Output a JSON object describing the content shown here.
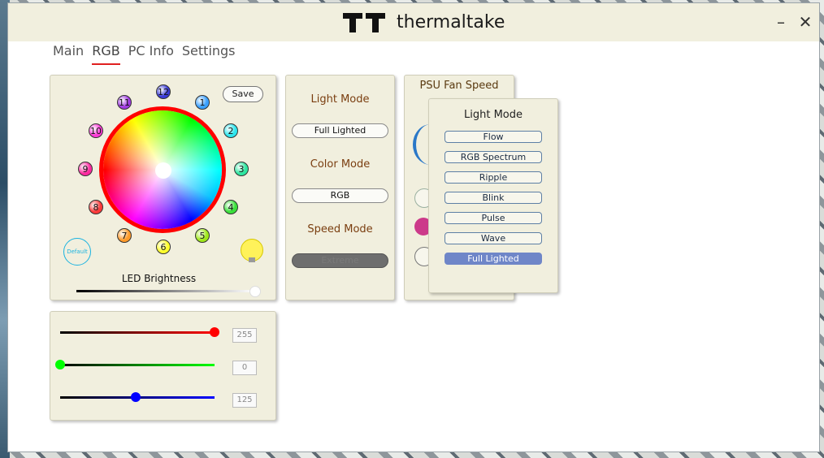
{
  "window": {
    "brand": "thermaltake",
    "minimize_glyph": "–",
    "close_glyph": "✕"
  },
  "tabs": [
    {
      "label": "Main"
    },
    {
      "label": "RGB"
    },
    {
      "label": "PC Info"
    },
    {
      "label": "Settings"
    }
  ],
  "active_tab": "RGB",
  "rgb_panel": {
    "save_label": "Save",
    "default_label": "Default",
    "brightness_label": "LED Brightness",
    "brightness_level": 1.0,
    "leds": [
      {
        "num": "12",
        "color": "#3a3ad8"
      },
      {
        "num": "1",
        "color": "#3aa0ff"
      },
      {
        "num": "2",
        "color": "#2ee6ee"
      },
      {
        "num": "3",
        "color": "#2ee6a0"
      },
      {
        "num": "4",
        "color": "#3ae03a"
      },
      {
        "num": "5",
        "color": "#9fe81a"
      },
      {
        "num": "6",
        "color": "#ffff2a"
      },
      {
        "num": "7",
        "color": "#ff9a2a"
      },
      {
        "num": "8",
        "color": "#ff3a3a"
      },
      {
        "num": "9",
        "color": "#ff2aa0"
      },
      {
        "num": "10",
        "color": "#ff3ad8"
      },
      {
        "num": "11",
        "color": "#a03ae0"
      }
    ]
  },
  "color_sliders": [
    {
      "value": "255",
      "color": "#ff0000",
      "level": 1.0
    },
    {
      "value": "0",
      "color": "#00ff00",
      "level": 0.0
    },
    {
      "value": "125",
      "color": "#0000ff",
      "level": 0.49
    }
  ],
  "mode_panel": {
    "light_mode_title": "Light Mode",
    "light_mode_value": "Full Lighted",
    "color_mode_title": "Color Mode",
    "color_mode_value": "RGB",
    "speed_mode_title": "Speed Mode",
    "speed_mode_value": "Extreme"
  },
  "psu_panel": {
    "title": "PSU Fan Speed"
  },
  "dropdown": {
    "title": "Light Mode",
    "options": [
      "Flow",
      "RGB Spectrum",
      "Ripple",
      "Blink",
      "Pulse",
      "Wave",
      "Full Lighted"
    ],
    "selected": "Full Lighted"
  }
}
